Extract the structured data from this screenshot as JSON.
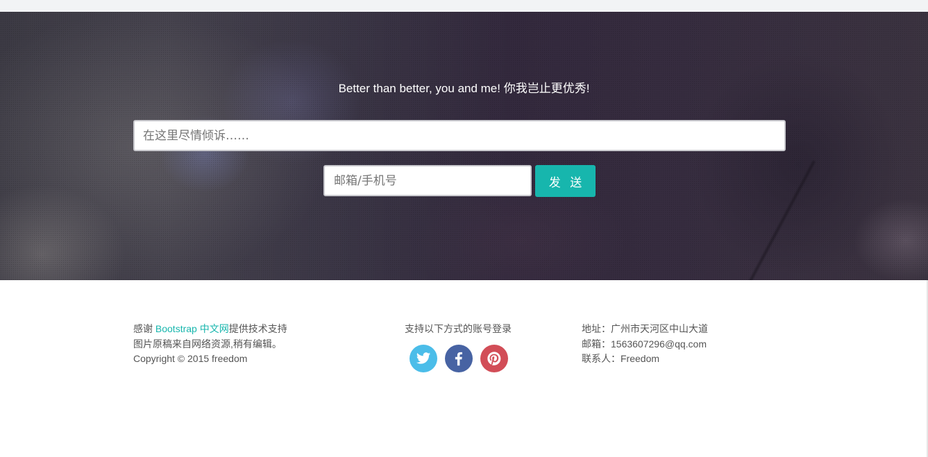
{
  "hero": {
    "tagline": "Better than better, you and me! 你我岂止更优秀!",
    "message_placeholder": "在这里尽情倾诉……",
    "contact_placeholder": "邮箱/手机号",
    "send_label": "发 送"
  },
  "footer": {
    "credits": {
      "thanks_prefix": "感谢 ",
      "thanks_link": "Bootstrap 中文网",
      "thanks_suffix": "提供技术支持",
      "images_note": "图片原稿来自网络资源,稍有编辑。",
      "copyright": "Copyright © 2015 freedom"
    },
    "social": {
      "heading": "支持以下方式的账号登录",
      "icons": [
        "twitter-icon",
        "facebook-icon",
        "pinterest-icon"
      ],
      "colors": {
        "twitter": "#4bbde9",
        "facebook": "#4763a3",
        "pinterest": "#d24d57"
      }
    },
    "contact": {
      "address": "地址：广州市天河区中山大道",
      "email": "邮箱：1563607296@qq.com",
      "person": "联系人：Freedom"
    }
  },
  "colors": {
    "accent": "#17b6ad",
    "footer_text": "#555555",
    "hero_text": "#ffffff"
  }
}
